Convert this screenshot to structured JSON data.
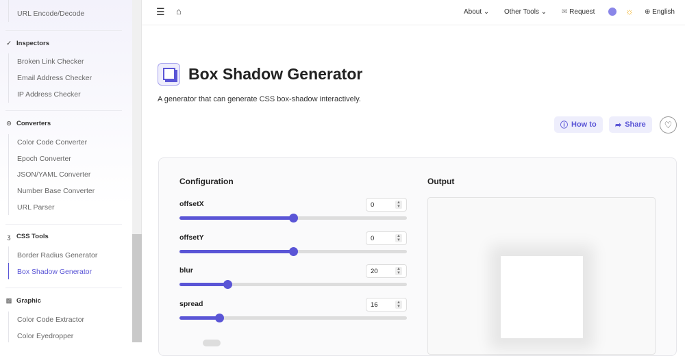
{
  "sidebar": {
    "top_item": "URL Encode/Decode",
    "groups": [
      {
        "title": "Inspectors",
        "icon": "check-icon",
        "items": [
          "Broken Link Checker",
          "Email Address Checker",
          "IP Address Checker"
        ]
      },
      {
        "title": "Converters",
        "icon": "play-circle-icon",
        "items": [
          "Color Code Converter",
          "Epoch Converter",
          "JSON/YAML Converter",
          "Number Base Converter",
          "URL Parser"
        ]
      },
      {
        "title": "CSS Tools",
        "icon": "css-icon",
        "items": [
          "Border Radius Generator",
          "Box Shadow Generator"
        ]
      },
      {
        "title": "Graphic",
        "icon": "image-icon",
        "items": [
          "Color Code Extractor",
          "Color Eyedropper"
        ]
      }
    ],
    "active": "Box Shadow Generator"
  },
  "topbar": {
    "about": "About",
    "other_tools": "Other Tools",
    "request": "Request",
    "language": "English"
  },
  "page": {
    "title": "Box Shadow Generator",
    "description": "A generator that can generate CSS box-shadow interactively.",
    "how_to": "How to",
    "share": "Share"
  },
  "config": {
    "title": "Configuration",
    "fields": [
      {
        "label": "offsetX",
        "value": "0",
        "fraction": 0.5
      },
      {
        "label": "offsetY",
        "value": "0",
        "fraction": 0.5
      },
      {
        "label": "blur",
        "value": "20",
        "fraction": 0.21
      },
      {
        "label": "spread",
        "value": "16",
        "fraction": 0.175
      }
    ]
  },
  "output": {
    "title": "Output"
  },
  "colors": {
    "accent": "#5a55d6"
  }
}
